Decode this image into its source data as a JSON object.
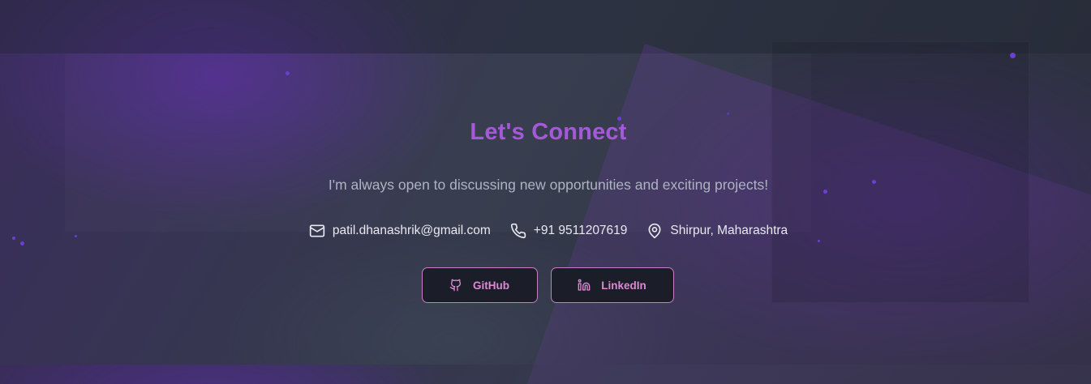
{
  "contact": {
    "heading": "Let's Connect",
    "subtitle": "I'm always open to discussing new opportunities and exciting projects!",
    "items": [
      {
        "icon": "mail-icon",
        "text": "patil.dhanashrik@gmail.com"
      },
      {
        "icon": "phone-icon",
        "text": "+91 9511207619"
      },
      {
        "icon": "map-pin-icon",
        "text": "Shirpur, Maharashtra"
      }
    ],
    "buttons": [
      {
        "icon": "github-icon",
        "label": "GitHub"
      },
      {
        "icon": "linkedin-icon",
        "label": "LinkedIn"
      }
    ]
  },
  "colors": {
    "heading": "#a45ad8",
    "button_border": "#c77fc6",
    "button_text": "#dc8ad4",
    "button_background": "#1b1e29",
    "particle": "#6b3fd1"
  }
}
